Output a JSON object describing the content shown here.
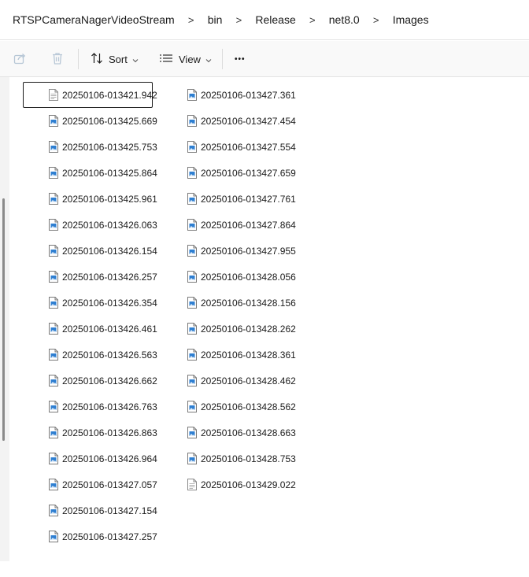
{
  "breadcrumb": {
    "items": [
      "RTSPCameraNagerVideoStream",
      "bin",
      "Release",
      "net8.0",
      "Images"
    ],
    "separator": ">"
  },
  "toolbar": {
    "share_icon": "share-icon",
    "delete_icon": "trash-icon",
    "sort_label": "Sort",
    "view_label": "View",
    "more_label": "•••"
  },
  "colors": {
    "image_icon_blue": "#2f7fd1",
    "text_icon_gray": "#8a8a8a",
    "toolbar_bg": "#f9f9f9",
    "scrollbar_thumb": "#8a8a8a"
  },
  "files": {
    "column1": [
      {
        "name": "20250106-013421.942",
        "icon": "text-file-icon",
        "focused": true
      },
      {
        "name": "20250106-013425.669",
        "icon": "image-file-icon"
      },
      {
        "name": "20250106-013425.753",
        "icon": "image-file-icon"
      },
      {
        "name": "20250106-013425.864",
        "icon": "image-file-icon"
      },
      {
        "name": "20250106-013425.961",
        "icon": "image-file-icon"
      },
      {
        "name": "20250106-013426.063",
        "icon": "image-file-icon"
      },
      {
        "name": "20250106-013426.154",
        "icon": "image-file-icon"
      },
      {
        "name": "20250106-013426.257",
        "icon": "image-file-icon"
      },
      {
        "name": "20250106-013426.354",
        "icon": "image-file-icon"
      },
      {
        "name": "20250106-013426.461",
        "icon": "image-file-icon"
      },
      {
        "name": "20250106-013426.563",
        "icon": "image-file-icon"
      },
      {
        "name": "20250106-013426.662",
        "icon": "image-file-icon"
      },
      {
        "name": "20250106-013426.763",
        "icon": "image-file-icon"
      },
      {
        "name": "20250106-013426.863",
        "icon": "image-file-icon"
      },
      {
        "name": "20250106-013426.964",
        "icon": "image-file-icon"
      },
      {
        "name": "20250106-013427.057",
        "icon": "image-file-icon"
      },
      {
        "name": "20250106-013427.154",
        "icon": "image-file-icon"
      },
      {
        "name": "20250106-013427.257",
        "icon": "image-file-icon"
      }
    ],
    "column2": [
      {
        "name": "20250106-013427.361",
        "icon": "image-file-icon"
      },
      {
        "name": "20250106-013427.454",
        "icon": "image-file-icon"
      },
      {
        "name": "20250106-013427.554",
        "icon": "image-file-icon"
      },
      {
        "name": "20250106-013427.659",
        "icon": "image-file-icon"
      },
      {
        "name": "20250106-013427.761",
        "icon": "image-file-icon"
      },
      {
        "name": "20250106-013427.864",
        "icon": "image-file-icon"
      },
      {
        "name": "20250106-013427.955",
        "icon": "image-file-icon"
      },
      {
        "name": "20250106-013428.056",
        "icon": "image-file-icon"
      },
      {
        "name": "20250106-013428.156",
        "icon": "image-file-icon"
      },
      {
        "name": "20250106-013428.262",
        "icon": "image-file-icon"
      },
      {
        "name": "20250106-013428.361",
        "icon": "image-file-icon"
      },
      {
        "name": "20250106-013428.462",
        "icon": "image-file-icon"
      },
      {
        "name": "20250106-013428.562",
        "icon": "image-file-icon"
      },
      {
        "name": "20250106-013428.663",
        "icon": "image-file-icon"
      },
      {
        "name": "20250106-013428.753",
        "icon": "image-file-icon"
      },
      {
        "name": "20250106-013429.022",
        "icon": "text-file-icon"
      }
    ]
  }
}
